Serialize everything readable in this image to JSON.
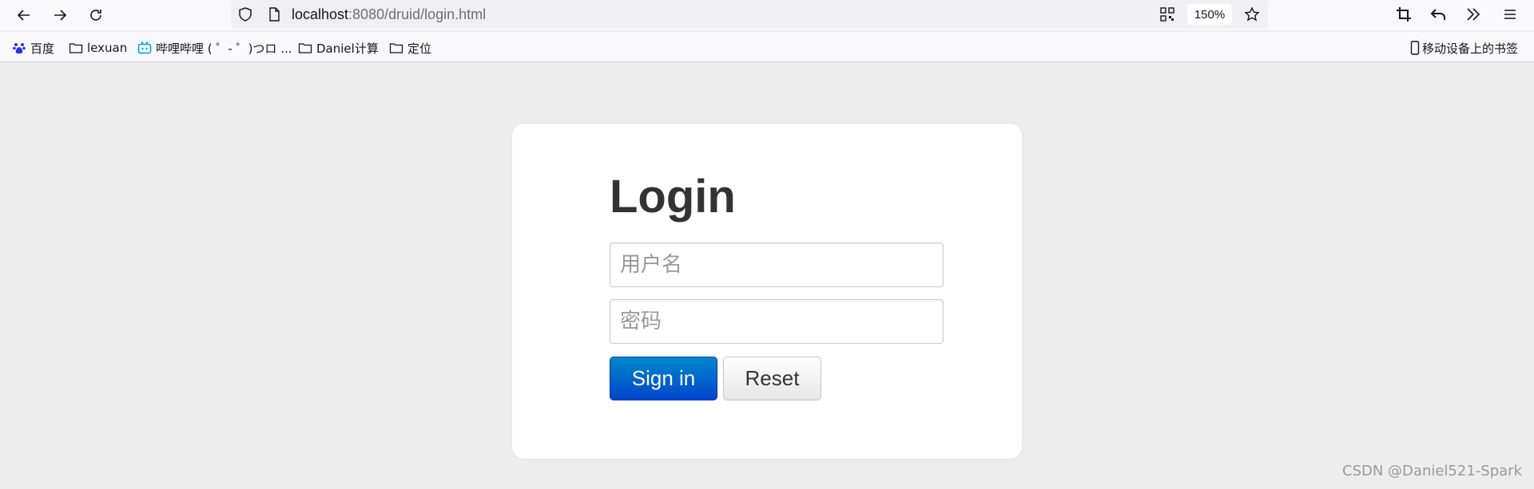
{
  "browser": {
    "url_host": "localhost",
    "url_path": ":8080/druid/login.html",
    "zoom": "150%",
    "bookmarks": [
      {
        "label": "百度",
        "icon": "baidu-paw-icon"
      },
      {
        "label": "lexuan",
        "icon": "folder-icon"
      },
      {
        "label": "哔哩哔哩 ( ゜- ゜)つロ ...",
        "icon": "bilibili-tv-icon"
      },
      {
        "label": "Daniel计算",
        "icon": "folder-icon"
      },
      {
        "label": "定位",
        "icon": "folder-icon"
      }
    ],
    "mobile_bookmarks": "移动设备上的书签",
    "colors": {
      "chrome": "#f9f9fb",
      "urlbar": "#f0f0f4",
      "baidu": "#2932e1",
      "bilibili": "#00a1d6"
    }
  },
  "page": {
    "title": "Login",
    "username_placeholder": "用户名",
    "password_placeholder": "密码",
    "signin_label": "Sign in",
    "reset_label": "Reset",
    "colors": {
      "background": "#ededed",
      "primary": "#0066cc",
      "title": "#333333"
    }
  },
  "watermark": "CSDN @Daniel521-Spark"
}
